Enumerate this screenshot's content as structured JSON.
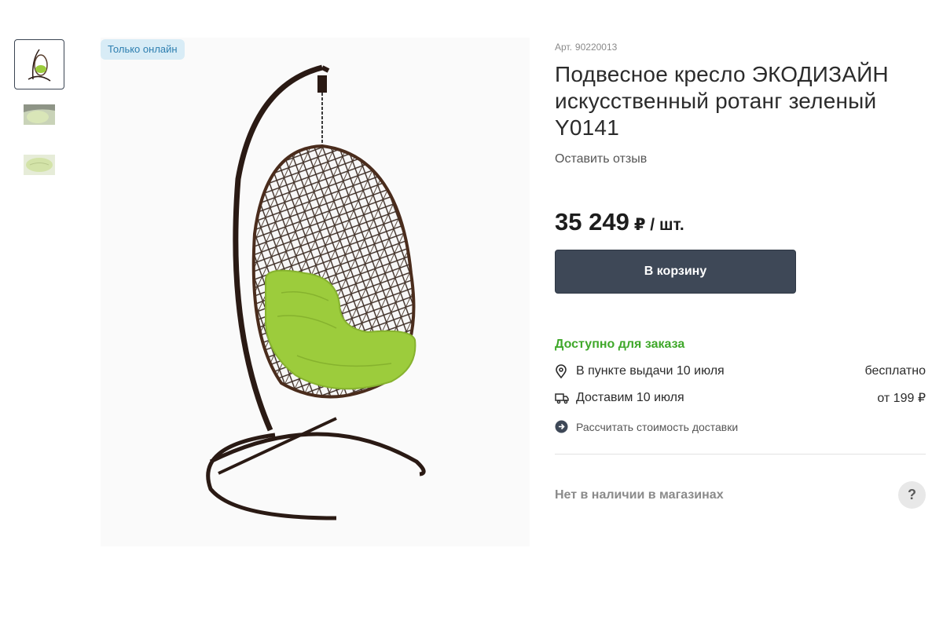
{
  "badge": "Только онлайн",
  "product": {
    "sku_label": "Арт.",
    "sku": "90220013",
    "title": "Подвесное кресло ЭКОДИЗАЙН искусственный ротанг зеленый Y0141",
    "review_link": "Оставить отзыв",
    "price": "35 249",
    "price_unit": "₽ / шт.",
    "cart_button": "В корзину"
  },
  "availability": {
    "status": "Доступно для заказа",
    "status_color": "#3fa82a",
    "pickup": {
      "label": "В пункте выдачи 10 июля",
      "price": "бесплатно",
      "icon": "location-pin-icon"
    },
    "delivery": {
      "label": "Доставим 10 июля",
      "price": "от 199 ₽",
      "icon": "truck-icon"
    },
    "calc_link": "Рассчитать стоимость доставки"
  },
  "stores": {
    "text": "Нет в наличии в магазинах",
    "help": "?"
  },
  "colors": {
    "button_bg": "#3e4857",
    "badge_bg": "#d8ecf6",
    "badge_text": "#2e7fb0",
    "cushion": "#9ccc3c",
    "frame": "#2a1a14"
  }
}
